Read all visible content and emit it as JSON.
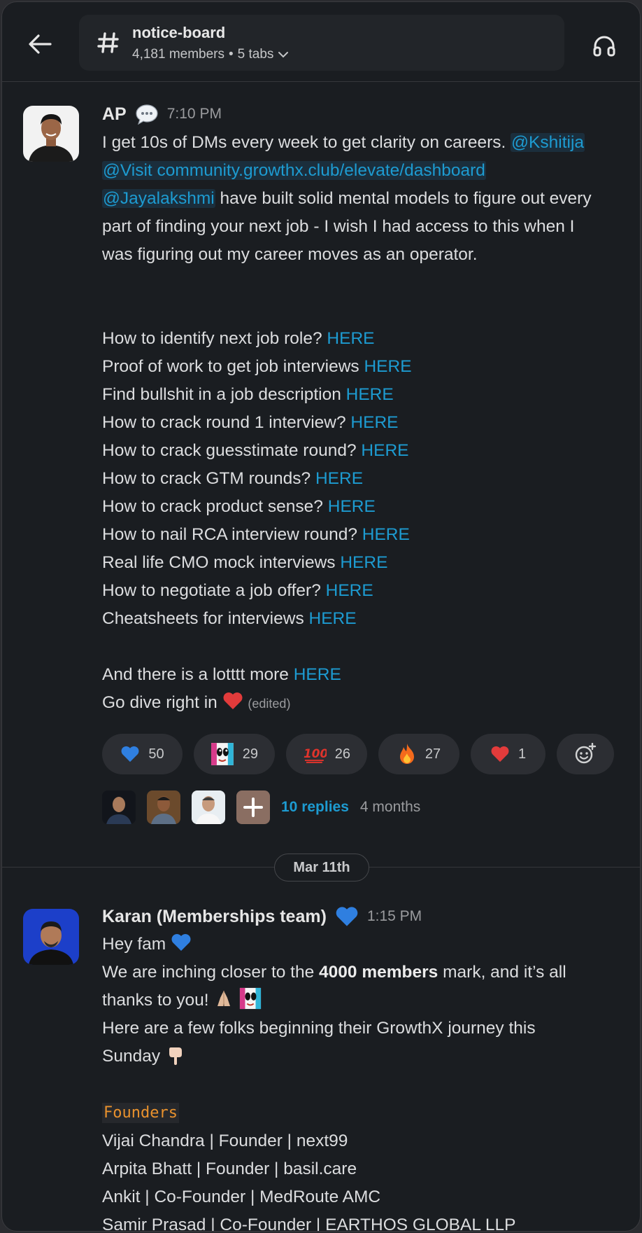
{
  "header": {
    "channel_name": "notice-board",
    "members": "4,181 members",
    "separator": "•",
    "tabs": "5 tabs"
  },
  "message1": {
    "author": "AP",
    "time": "7:10 PM",
    "line1_text": "I get 10s of DMs every week to get clarity on careers. ",
    "mention1": "@Kshitija",
    "mention2": "@Visit community.growthx.club/elevate/dashboard",
    "mention3": "@Jayalakshmi",
    "line3_text": " have built solid mental models to figure out every",
    "line4": "part of finding your next job - I wish I had access to this when I",
    "line5": "was figuring out my career moves as an operator.",
    "list": [
      {
        "text": "How to identify next job role? ",
        "link": "HERE"
      },
      {
        "text": "Proof of work to get job interviews ",
        "link": "HERE"
      },
      {
        "text": "Find bullshit in a job description ",
        "link": "HERE"
      },
      {
        "text": "How to crack round 1 interview? ",
        "link": "HERE"
      },
      {
        "text": "How to crack guesstimate round? ",
        "link": "HERE"
      },
      {
        "text": "How to crack GTM rounds? ",
        "link": "HERE"
      },
      {
        "text": "How to crack product sense? ",
        "link": "HERE"
      },
      {
        "text": "How to nail RCA interview round? ",
        "link": "HERE"
      },
      {
        "text": "Real life CMO mock interviews ",
        "link": "HERE"
      },
      {
        "text": "How to negotiate a job offer? ",
        "link": "HERE"
      },
      {
        "text": "Cheatsheets for interviews ",
        "link": "HERE"
      }
    ],
    "more_text": "And there is a lotttt more ",
    "more_link": "HERE",
    "final_text": "Go dive right in ",
    "edited": "(edited)",
    "reactions": [
      {
        "emoji": "blue-heart",
        "count": "50"
      },
      {
        "emoji": "custom-face",
        "count": "29"
      },
      {
        "emoji": "hundred",
        "count": "26"
      },
      {
        "emoji": "fire",
        "count": "27"
      },
      {
        "emoji": "red-heart",
        "count": "1"
      }
    ],
    "replies_label": "10 replies",
    "replies_time": "4 months"
  },
  "date_divider": "Mar 11th",
  "message2": {
    "author": "Karan (Memberships team)",
    "time": "1:15 PM",
    "line1": "Hey fam ",
    "line2_pre": "We are inching closer to the ",
    "line2_bold": "4000 members",
    "line2_post": " mark, and it’s all",
    "line3": "thanks to you! ",
    "line4": "Here are a few folks beginning their GrowthX journey this",
    "line5": "Sunday ",
    "section_label": "Founders",
    "founders": [
      "Vijai Chandra | Founder | next99",
      "Arpita Bhatt | Founder | basil.care",
      "Ankit | Co-Founder | MedRoute AMC",
      "Samir Prasad | Co-Founder | EARTHOS GLOBAL LLP"
    ]
  },
  "colors": {
    "background": "#1a1d21",
    "link": "#1d9bd1",
    "code": "#e8912d"
  }
}
